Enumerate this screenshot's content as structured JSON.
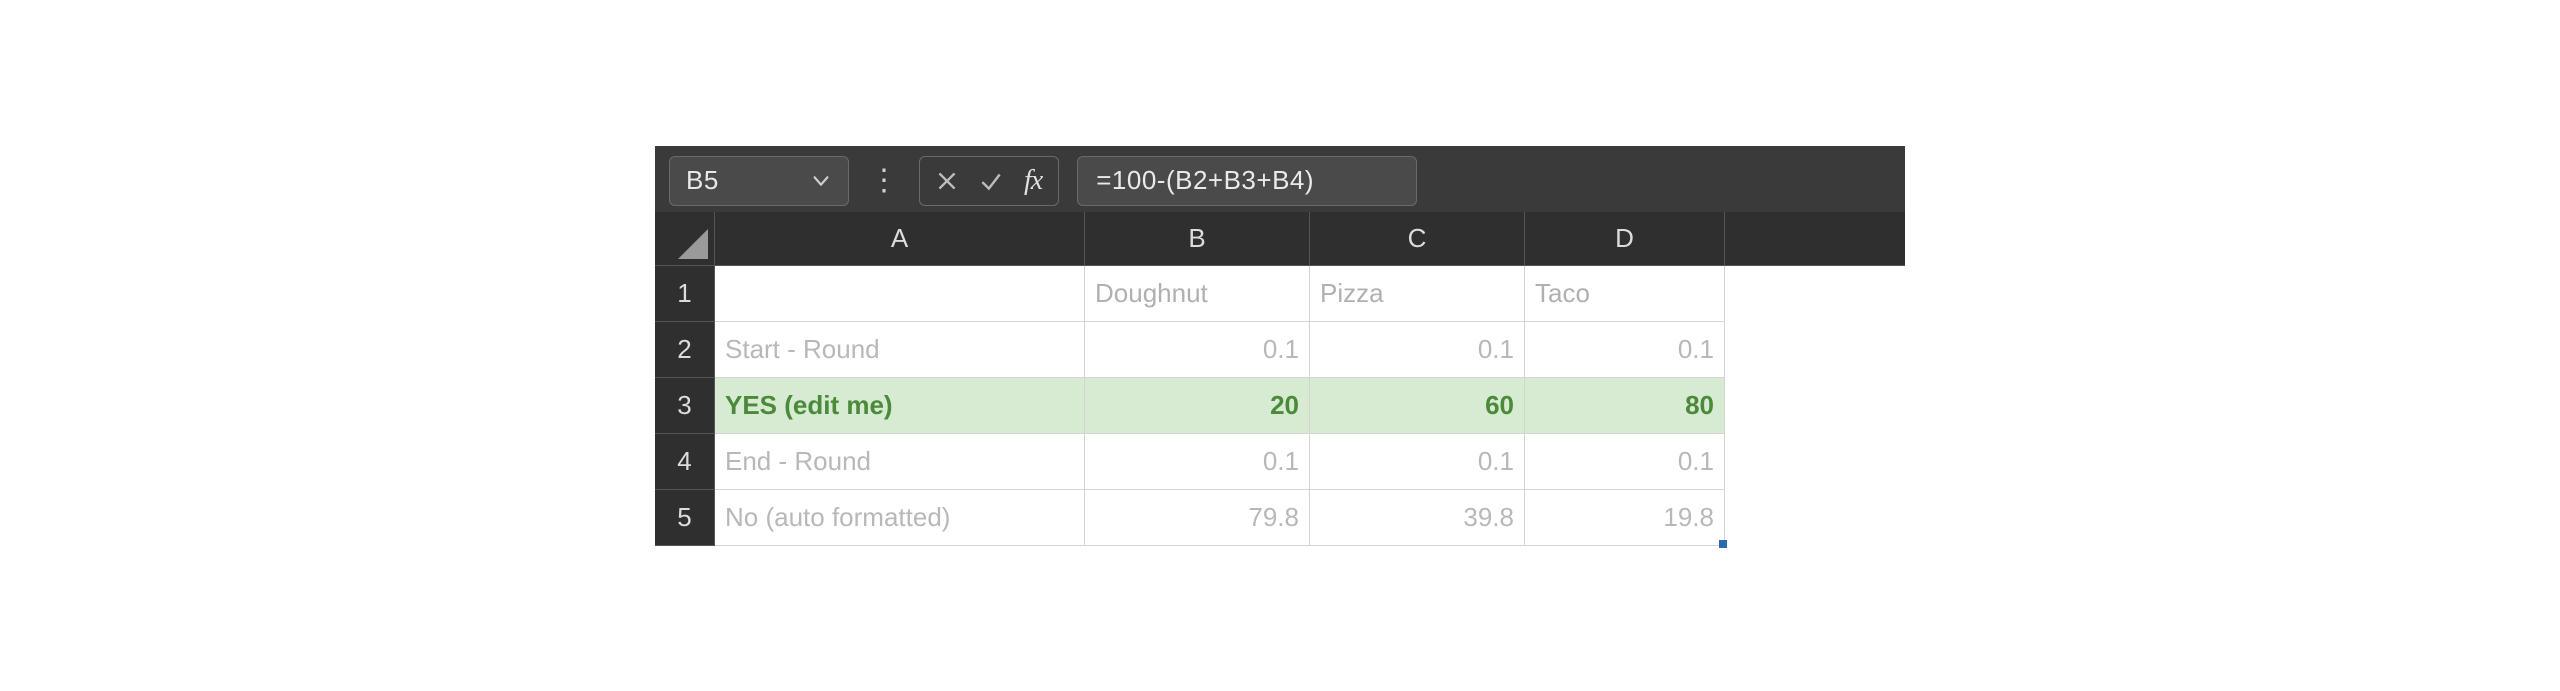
{
  "formula_bar": {
    "name_box": "B5",
    "formula": "=100-(B2+B3+B4)",
    "fx_label": "fx"
  },
  "columns": [
    "A",
    "B",
    "C",
    "D"
  ],
  "row_numbers": [
    "1",
    "2",
    "3",
    "4",
    "5"
  ],
  "headers": {
    "B": "Doughnut",
    "C": "Pizza",
    "D": "Taco"
  },
  "rows": [
    {
      "label": "Start - Round",
      "B": "0.1",
      "C": "0.1",
      "D": "0.1",
      "highlight": false
    },
    {
      "label": "YES (edit me)",
      "B": "20",
      "C": "60",
      "D": "80",
      "highlight": true
    },
    {
      "label": "End - Round",
      "B": "0.1",
      "C": "0.1",
      "D": "0.1",
      "highlight": false
    },
    {
      "label": "No (auto formatted)",
      "B": "79.8",
      "C": "39.8",
      "D": "19.8",
      "highlight": false
    }
  ]
}
